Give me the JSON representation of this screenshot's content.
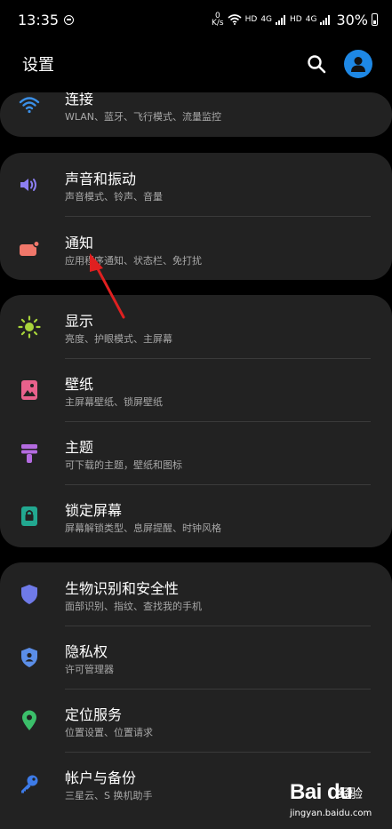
{
  "status_bar": {
    "time": "13:35",
    "net_speed_value": "0",
    "net_speed_unit": "K/s",
    "hd1": "HD",
    "net1": "4G",
    "hd2": "HD",
    "net2": "4G",
    "battery": "30%",
    "icons": [
      "do-not-disturb-icon",
      "wifi-icon",
      "cellular-signal-icon",
      "battery-icon"
    ]
  },
  "header": {
    "title": "设置",
    "search_icon": "search-icon",
    "profile_icon": "account-avatar-icon",
    "accent_color": "#1e88e5"
  },
  "groups": [
    {
      "items": [
        {
          "title": "连接",
          "subtitle": "WLAN、蓝牙、飞行模式、流量监控",
          "icon": "wifi-icon",
          "color": "#3b8fe6"
        }
      ]
    },
    {
      "items": [
        {
          "title": "声音和振动",
          "subtitle": "声音模式、铃声、音量",
          "icon": "volume-icon",
          "color": "#8c7ef2"
        },
        {
          "title": "通知",
          "subtitle": "应用程序通知、状态栏、免打扰",
          "icon": "notification-icon",
          "color": "#f0776a"
        }
      ]
    },
    {
      "items": [
        {
          "title": "显示",
          "subtitle": "亮度、护眼模式、主屏幕",
          "icon": "brightness-icon",
          "color": "#a8d43a"
        },
        {
          "title": "壁纸",
          "subtitle": "主屏幕壁纸、锁屏壁纸",
          "icon": "wallpaper-icon",
          "color": "#e8618c"
        },
        {
          "title": "主题",
          "subtitle": "可下载的主题，壁纸和图标",
          "icon": "theme-brush-icon",
          "color": "#b46be0"
        },
        {
          "title": "锁定屏幕",
          "subtitle": "屏幕解锁类型、息屏提醒、时钟风格",
          "icon": "lock-screen-icon",
          "color": "#22a890"
        }
      ]
    },
    {
      "items": [
        {
          "title": "生物识别和安全性",
          "subtitle": "面部识别、指纹、查找我的手机",
          "icon": "shield-icon",
          "color": "#6f7ae8"
        },
        {
          "title": "隐私权",
          "subtitle": "许可管理器",
          "icon": "privacy-shield-icon",
          "color": "#5b8ee8"
        },
        {
          "title": "定位服务",
          "subtitle": "位置设置、位置请求",
          "icon": "location-pin-icon",
          "color": "#3bbf6a"
        },
        {
          "title": "帐户与备份",
          "subtitle": "三星云、S 换机助手",
          "icon": "key-icon",
          "color": "#3d7be8"
        }
      ]
    }
  ],
  "annotation": {
    "color": "#e02020"
  },
  "watermark": {
    "logo": "Bai du",
    "jingyan": "经验",
    "url": "jingyan.baidu.com"
  }
}
